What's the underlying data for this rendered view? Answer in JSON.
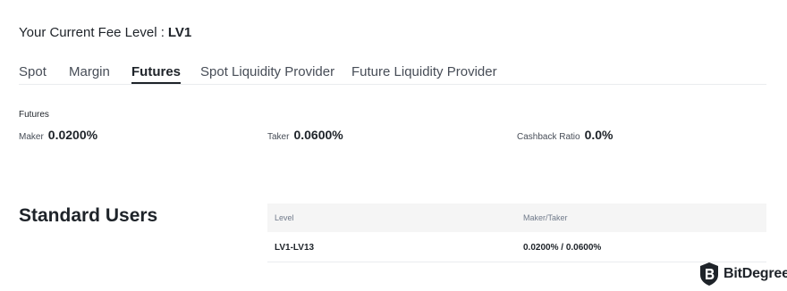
{
  "fee_level": {
    "label": "Your Current Fee Level :",
    "value": "LV1"
  },
  "tabs": [
    {
      "label": "Spot",
      "active": false
    },
    {
      "label": "Margin",
      "active": false
    },
    {
      "label": "Futures",
      "active": true
    },
    {
      "label": "Spot Liquidity Provider",
      "active": false
    },
    {
      "label": "Future Liquidity Provider",
      "active": false
    }
  ],
  "futures": {
    "section_label": "Futures",
    "maker": {
      "label": "Maker",
      "value": "0.0200%"
    },
    "taker": {
      "label": "Taker",
      "value": "0.0600%"
    },
    "cashback": {
      "label": "Cashback Ratio",
      "value": "0.0%"
    }
  },
  "standard_users": {
    "title": "Standard Users",
    "table": {
      "headers": [
        "Level",
        "Maker/Taker"
      ],
      "rows": [
        [
          "LV1-LV13",
          "0.0200% / 0.0600%"
        ]
      ]
    }
  },
  "watermark": {
    "text": "BitDegree",
    "icon": "bitdegree-logo-icon"
  }
}
